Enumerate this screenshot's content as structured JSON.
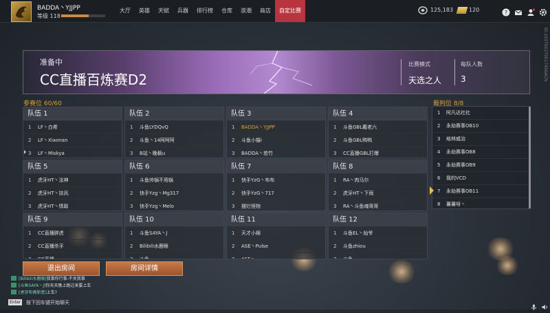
{
  "player": {
    "name": "BADDA丶YJJPP",
    "level_label": "等级 118",
    "xp_fraction": 0.62
  },
  "nav": {
    "items": [
      "大厅",
      "英雄",
      "天赋",
      "兵器",
      "排行榜",
      "仓库",
      "浪潮",
      "商店",
      "自定比赛"
    ],
    "active_index": 8
  },
  "currency": {
    "coins": "125,183",
    "gold": "120"
  },
  "side_code": "ID:103700270017450ACN",
  "room": {
    "status": "准备中",
    "title": "CC直播百炼赛D2",
    "mode_label": "比赛模式",
    "mode_value": "天选之人",
    "per_team_label": "每队人数",
    "per_team_value": "3"
  },
  "participants": {
    "label": "参赛位",
    "count": "60/60"
  },
  "referees": {
    "label": "裁判位",
    "count": "8/8",
    "list": [
      {
        "n": "1",
        "name": "阿凡达社社"
      },
      {
        "n": "2",
        "name": "永劫赛事OB10"
      },
      {
        "n": "3",
        "name": "格林威治"
      },
      {
        "n": "4",
        "name": "永劫赛事OB8"
      },
      {
        "n": "5",
        "name": "永劫赛事OB9"
      },
      {
        "n": "6",
        "name": "我的VCD"
      },
      {
        "n": "7",
        "name": "永劫赛事OB11"
      },
      {
        "n": "8",
        "name": "薯薯呀丶"
      }
    ]
  },
  "teams": [
    {
      "title": "队伍 1",
      "players": [
        {
          "n": "1",
          "name": "LF丶白希"
        },
        {
          "n": "2",
          "name": "LF丶Xiaonan"
        },
        {
          "n": "3",
          "name": "LF丶Miskya"
        }
      ]
    },
    {
      "title": "队伍 2",
      "players": [
        {
          "n": "1",
          "name": "斗鱼LYDQvQ"
        },
        {
          "n": "2",
          "name": "斗鱼丶14阿阿阿"
        },
        {
          "n": "3",
          "name": "B站丶晚枫u"
        }
      ]
    },
    {
      "title": "队伍 3",
      "players": [
        {
          "n": "1",
          "name": "BADDA丶YJJPP"
        },
        {
          "n": "2",
          "name": "斗鱼小猫i"
        },
        {
          "n": "3",
          "name": "BADDA丶若竹"
        }
      ]
    },
    {
      "title": "队伍 4",
      "players": [
        {
          "n": "1",
          "name": "斗鱼GBL戴老六"
        },
        {
          "n": "2",
          "name": "斗鱼GBL鸭鸭"
        },
        {
          "n": "3",
          "name": "CC直播GBL打爆"
        }
      ]
    },
    {
      "title": "队伍 5",
      "players": [
        {
          "n": "1",
          "name": "虎牙HT丶法神"
        },
        {
          "n": "2",
          "name": "虎牙HT丶扶风"
        },
        {
          "n": "3",
          "name": "虎牙HT丶情敌"
        }
      ]
    },
    {
      "title": "队伍 6",
      "players": [
        {
          "n": "1",
          "name": "斗鱼帅锅不用锅"
        },
        {
          "n": "2",
          "name": "快手Yzg丶Mg317"
        },
        {
          "n": "3",
          "name": "快手Yzg丶Melo"
        }
      ]
    },
    {
      "title": "队伍 7",
      "players": [
        {
          "n": "1",
          "name": "快手YzG丶布布"
        },
        {
          "n": "2",
          "name": "快手YzG丶717"
        },
        {
          "n": "3",
          "name": "摆烂怪物"
        }
      ]
    },
    {
      "title": "队伍 8",
      "players": [
        {
          "n": "1",
          "name": "RA丶肉马尔"
        },
        {
          "n": "2",
          "name": "虎牙HT丶下雨"
        },
        {
          "n": "3",
          "name": "RA丶斗鱼魂哥哥"
        }
      ]
    },
    {
      "title": "队伍 9",
      "players": [
        {
          "n": "1",
          "name": "CC直播胖虎"
        },
        {
          "n": "2",
          "name": "CC直播杀手"
        },
        {
          "n": "3",
          "name": "CC直播..."
        }
      ]
    },
    {
      "title": "队伍 10",
      "players": [
        {
          "n": "1",
          "name": "斗鱼SAYA丶J"
        },
        {
          "n": "2",
          "name": "Bilibili水鹿眼"
        },
        {
          "n": "3",
          "name": "斗鱼..."
        }
      ]
    },
    {
      "title": "队伍 11",
      "players": [
        {
          "n": "1",
          "name": "天才小棉"
        },
        {
          "n": "2",
          "name": "ASE丶Pulse"
        },
        {
          "n": "3",
          "name": "ASE丶..."
        }
      ]
    },
    {
      "title": "队伍 12",
      "players": [
        {
          "n": "1",
          "name": "斗鱼EL丶灿爷"
        },
        {
          "n": "2",
          "name": "斗鱼zhiou"
        },
        {
          "n": "3",
          "name": "斗鱼..."
        }
      ]
    }
  ],
  "buttons": {
    "exit": "退出房间",
    "details": "房间详情"
  },
  "chat": {
    "messages": [
      {
        "user": "[Bilibili水鹿眼]",
        "text": "我事你行事-不关我事"
      },
      {
        "user": "[斗鱼SAYA丶J]",
        "text": "你天天晚上跑过来要上车"
      },
      {
        "user": "[虎牙布俩斩意]",
        "text": "上车?"
      }
    ],
    "enter_key": "Enter",
    "hint": "按下回车键开始聊天"
  },
  "colors": {
    "accent_orange": "#d9a13a",
    "nav_active": "#b8343e",
    "button": "#b0653a"
  }
}
